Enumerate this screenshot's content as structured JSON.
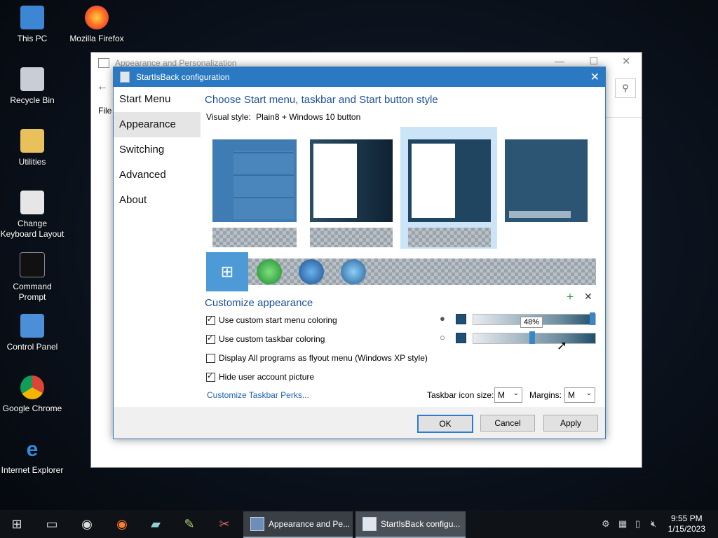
{
  "desktop": {
    "icons": [
      {
        "label": "This PC"
      },
      {
        "label": "Mozilla Firefox"
      },
      {
        "label": "Recycle Bin"
      },
      {
        "label": "Utilities"
      },
      {
        "label": "Change Keyboard Layout"
      },
      {
        "label": "Command Prompt"
      },
      {
        "label": "Control Panel"
      },
      {
        "label": "Google Chrome"
      },
      {
        "label": "Internet Explorer"
      }
    ]
  },
  "bg_window": {
    "title": "Appearance and Personalization",
    "file_menu": "File"
  },
  "dialog": {
    "title": "StartIsBack configuration",
    "sidebar": [
      "Start Menu",
      "Appearance",
      "Switching",
      "Advanced",
      "About"
    ],
    "selected_sidebar": "Appearance",
    "heading_style": "Choose Start menu, taskbar and Start button style",
    "visual_style_label": "Visual style:",
    "visual_style_value": "Plain8 + Windows 10 button",
    "heading_customize": "Customize appearance",
    "options": [
      {
        "label": "Use custom start menu coloring",
        "checked": true
      },
      {
        "label": "Use custom taskbar coloring",
        "checked": true
      },
      {
        "label": "Display All programs as flyout menu (Windows XP style)",
        "checked": false
      },
      {
        "label": "Hide user account picture",
        "checked": true
      }
    ],
    "opacity_tooltip": "48%",
    "start_menu_opacity_pct": 100,
    "taskbar_opacity_pct": 48,
    "perks_link": "Customize Taskbar Perks...",
    "taskbar_icon_size_label": "Taskbar icon size:",
    "taskbar_icon_size_value": "M",
    "margins_label": "Margins:",
    "margins_value": "M",
    "buttons": {
      "ok": "OK",
      "cancel": "Cancel",
      "apply": "Apply"
    }
  },
  "taskbar": {
    "tasks": [
      {
        "label": "Appearance and Pe..."
      },
      {
        "label": "StartIsBack configu..."
      }
    ],
    "time": "9:55 PM",
    "date": "1/15/2023"
  }
}
